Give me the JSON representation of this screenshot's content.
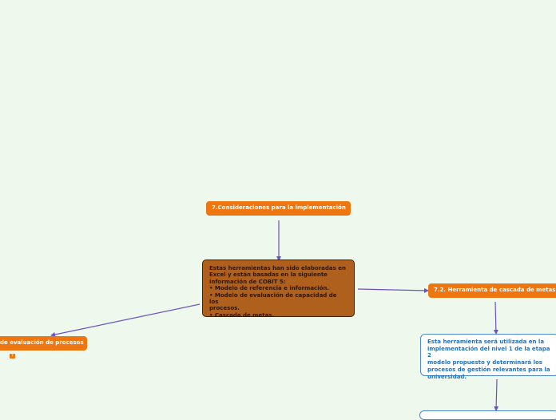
{
  "colors": {
    "background": "#eef8ec",
    "topic_orange": "#ee7611",
    "central_brown": "#b0601d",
    "note_blue_text": "#1e73c0",
    "connector_purple": "#6a52c4"
  },
  "nodes": {
    "top": {
      "label": "7.Consideraciones para la implementación"
    },
    "central": {
      "text": "Estas herramientas han sido elaboradas en\nExcel y están basadas en la siguiente\ninformación de COBIT 5:\n• Modelo de referencia e información.\n• Modelo de evaluación de capacidad de los\nprocesos.\n• Cascada de metas."
    },
    "right": {
      "label": "7.2. Herramienta de cascada de metas"
    },
    "left": {
      "label": "de evaluación de procesos"
    },
    "left_badge": {
      "icon": "note-icon",
      "glyph": "?"
    },
    "note": {
      "text": "Esta herramienta será utilizada en la\nimplementación del nivel 1 de la etapa 2\nmodelo propuesto y determinará los\nprocesos de gestión relevantes para la\nuniversidad."
    },
    "bottom_stub": {
      "text": ""
    }
  }
}
